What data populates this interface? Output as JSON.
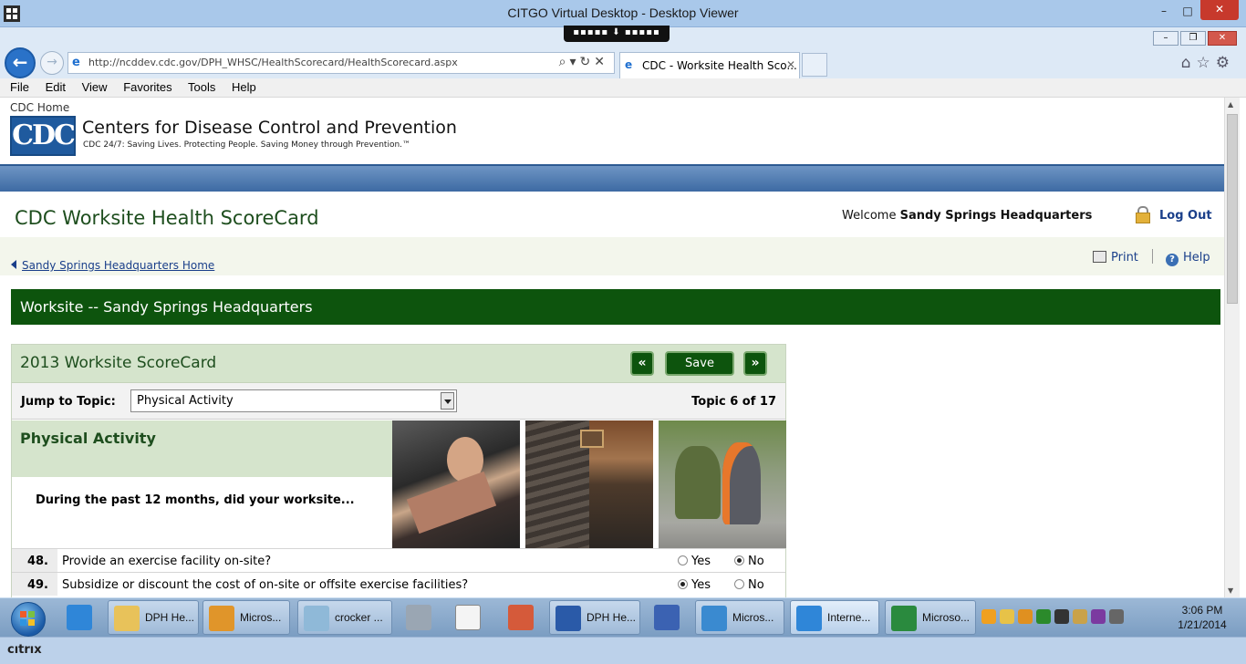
{
  "citrix": {
    "window_title": "CITGO Virtual Desktop - Desktop Viewer",
    "toolbar_handle": "▪▪▪▪▪ ⬇ ▪▪▪▪▪",
    "logo": "cıtrıx"
  },
  "browser": {
    "address": "http://ncddev.cdc.gov/DPH_WHSC/HealthScorecard/HealthScorecard.aspx",
    "tab_title": "CDC - Worksite Health Sco...",
    "menu": [
      "File",
      "Edit",
      "View",
      "Favorites",
      "Tools",
      "Help"
    ]
  },
  "cdc": {
    "home_link": "CDC Home",
    "logo_text": "CDC",
    "org_name": "Centers for Disease Control and Prevention",
    "tagline": "CDC 24/7: Saving Lives. Protecting People. Saving Money through Prevention.™"
  },
  "app": {
    "title": "CDC Worksite Health ScoreCard",
    "welcome_prefix": "Welcome",
    "welcome_name": "Sandy Springs Headquarters",
    "logout": "Log Out",
    "breadcrumb": "Sandy Springs Headquarters Home",
    "print": "Print",
    "help": "Help",
    "worksite_banner": "Worksite -- Sandy Springs Headquarters"
  },
  "scorecard": {
    "title": "2013 Worksite ScoreCard",
    "prev_label": "«",
    "save_label": "Save",
    "next_label": "»",
    "jump_label": "Jump to Topic:",
    "selected_topic": "Physical Activity",
    "topic_count": "Topic 6 of 17",
    "topic_name": "Physical Activity",
    "question_intro": "During the past 12 months, did your worksite...",
    "questions": [
      {
        "num": "48.",
        "text": "Provide an exercise facility on-site?",
        "yes": "Yes",
        "no": "No",
        "selected": "No"
      },
      {
        "num": "49.",
        "text": "Subsidize or discount the cost of on-site or offsite exercise facilities?",
        "yes": "Yes",
        "no": "No",
        "selected": "Yes"
      }
    ]
  },
  "taskbar": {
    "items": [
      "DPH He...",
      "Micros...",
      "crocker ...",
      "DPH He...",
      "Micros...",
      "Interne...",
      "Microso..."
    ],
    "time": "3:06 PM",
    "date": "1/21/2014"
  }
}
